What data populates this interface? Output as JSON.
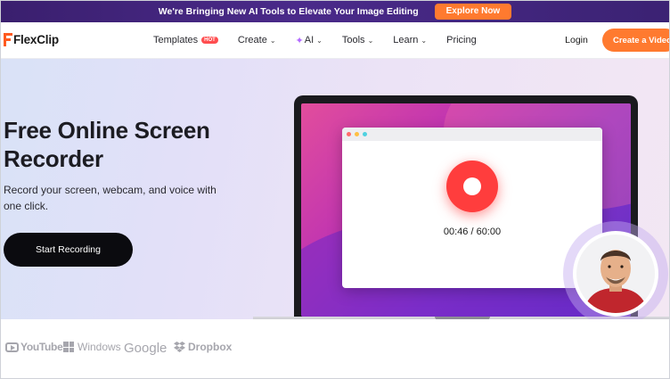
{
  "promo": {
    "text": "We're Bringing New AI Tools to Elevate Your Image Editing",
    "button": "Explore Now"
  },
  "brand": {
    "name": "FlexClip",
    "accent": "#ff7a2f"
  },
  "nav": {
    "items": [
      {
        "label": "Templates",
        "badge": "HOT"
      },
      {
        "label": "Create",
        "dropdown": true
      },
      {
        "label": "AI",
        "dropdown": true,
        "icon": "sparkle-icon"
      },
      {
        "label": "Tools",
        "dropdown": true
      },
      {
        "label": "Learn",
        "dropdown": true
      },
      {
        "label": "Pricing"
      }
    ],
    "login": "Login",
    "cta": "Create a Video"
  },
  "hero": {
    "title": "Free Online Screen Recorder",
    "subtitle": "Record your screen, webcam, and voice with one click.",
    "button": "Start Recording",
    "timer": "00:46 / 60:00"
  },
  "logos": {
    "youtube": "YouTube",
    "windows": "Windows",
    "google": "Google",
    "dropbox": "Dropbox"
  }
}
